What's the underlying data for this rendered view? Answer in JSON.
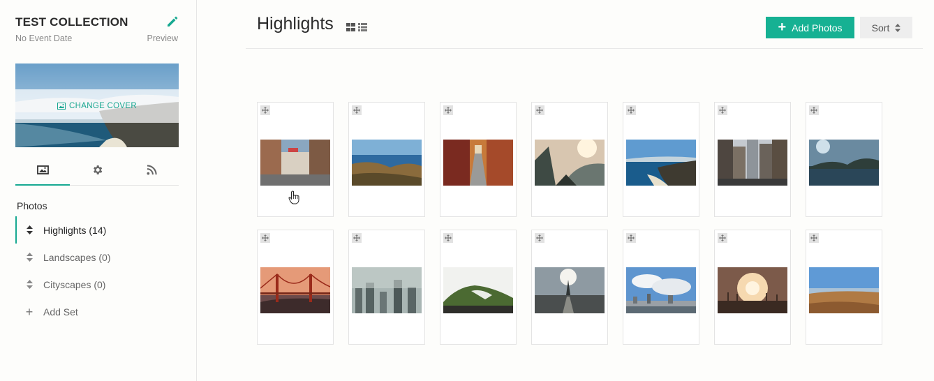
{
  "collection": {
    "title": "TEST COLLECTION",
    "event_date": "No Event Date",
    "preview_label": "Preview",
    "change_cover_label": "CHANGE COVER"
  },
  "tabs": [
    {
      "icon": "image-icon",
      "active": true
    },
    {
      "icon": "gear-icon",
      "active": false
    },
    {
      "icon": "rss-icon",
      "active": false
    }
  ],
  "sidebar": {
    "photos_heading": "Photos",
    "sets": [
      {
        "label": "Highlights (14)",
        "active": true
      },
      {
        "label": "Landscapes (0)",
        "active": false
      },
      {
        "label": "Cityscapes (0)",
        "active": false
      }
    ],
    "add_set_label": "Add Set"
  },
  "header": {
    "title": "Highlights",
    "add_photos_label": "Add Photos",
    "sort_label": "Sort"
  },
  "colors": {
    "accent": "#16b193",
    "sort_bg": "#eeeeee"
  },
  "photos": [
    {
      "name": "street-alley-photo"
    },
    {
      "name": "coastal-cliff-photo"
    },
    {
      "name": "narrow-street-photo"
    },
    {
      "name": "misty-mountain-photo"
    },
    {
      "name": "beach-coast-photo"
    },
    {
      "name": "city-buildings-photo"
    },
    {
      "name": "lake-mountain-photo"
    },
    {
      "name": "golden-gate-bridge-photo"
    },
    {
      "name": "foggy-city-photo"
    },
    {
      "name": "green-hill-photo"
    },
    {
      "name": "eiffel-tower-city-photo"
    },
    {
      "name": "city-skyline-clouds-photo"
    },
    {
      "name": "sunset-field-photo"
    },
    {
      "name": "desert-landscape-photo"
    }
  ]
}
